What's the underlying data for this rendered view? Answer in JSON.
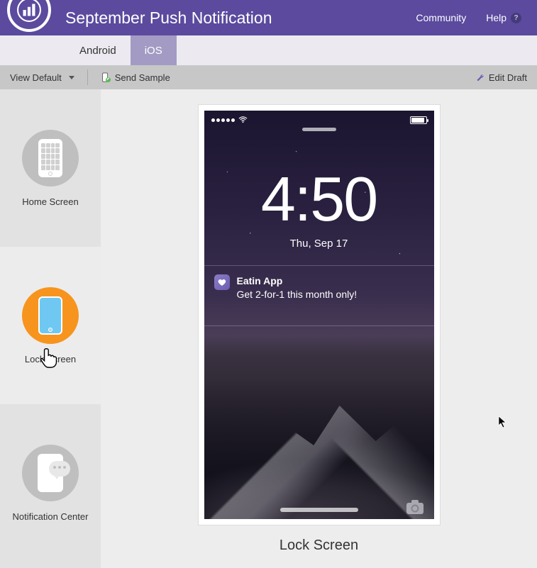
{
  "header": {
    "title": "September Push Notification",
    "links": {
      "community": "Community",
      "help": "Help"
    }
  },
  "tabs": {
    "android": "Android",
    "ios": "iOS"
  },
  "toolbar": {
    "view_label": "View Default",
    "send_sample": "Send Sample",
    "edit_draft": "Edit Draft"
  },
  "sidebar": {
    "home": "Home Screen",
    "lock": "Lock Screen",
    "nc": "Notification Center"
  },
  "preview": {
    "caption": "Lock Screen",
    "clock_time": "4:50",
    "clock_date": "Thu, Sep 17",
    "notification": {
      "app_name": "Eatin App",
      "message": "Get 2-for-1 this month only!"
    }
  },
  "colors": {
    "brand_purple": "#5b4a9e",
    "accent_orange": "#f7941e"
  }
}
